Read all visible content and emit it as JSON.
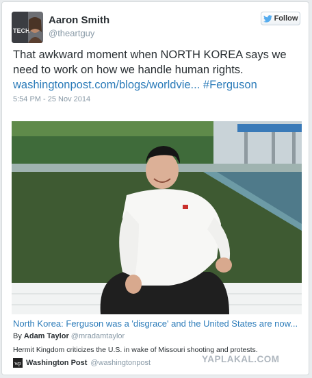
{
  "user": {
    "name": "Aaron Smith",
    "handle": "@theartguy",
    "avatar_text": "TECH"
  },
  "follow_label": "Follow",
  "tweet": {
    "text": "That awkward moment when NORTH KOREA says we need to work on how we handle human rights.",
    "link": "washingtonpost.com/blogs/worldvie...",
    "hashtag": "#Ferguson",
    "timestamp": "5:54 PM - 25 Nov 2014"
  },
  "card": {
    "headline": "North Korea: Ferguson was a 'disgrace' and the United States are now...",
    "by_prefix": "By",
    "author": "Adam Taylor",
    "author_handle": "@mradamtaylor",
    "description": "Hermit Kingdom criticizes the U.S. in wake of Missouri shooting and protests.",
    "source_name": "Washington Post",
    "source_handle": "@washingtonpost",
    "source_logo": "wp"
  },
  "watermark": "YAPLAKAL.COM",
  "colors": {
    "link": "#2b7bb9",
    "muted": "#8899a6",
    "text": "#292f33"
  },
  "icons": [
    "twitter-bird-icon",
    "washington-post-logo"
  ]
}
